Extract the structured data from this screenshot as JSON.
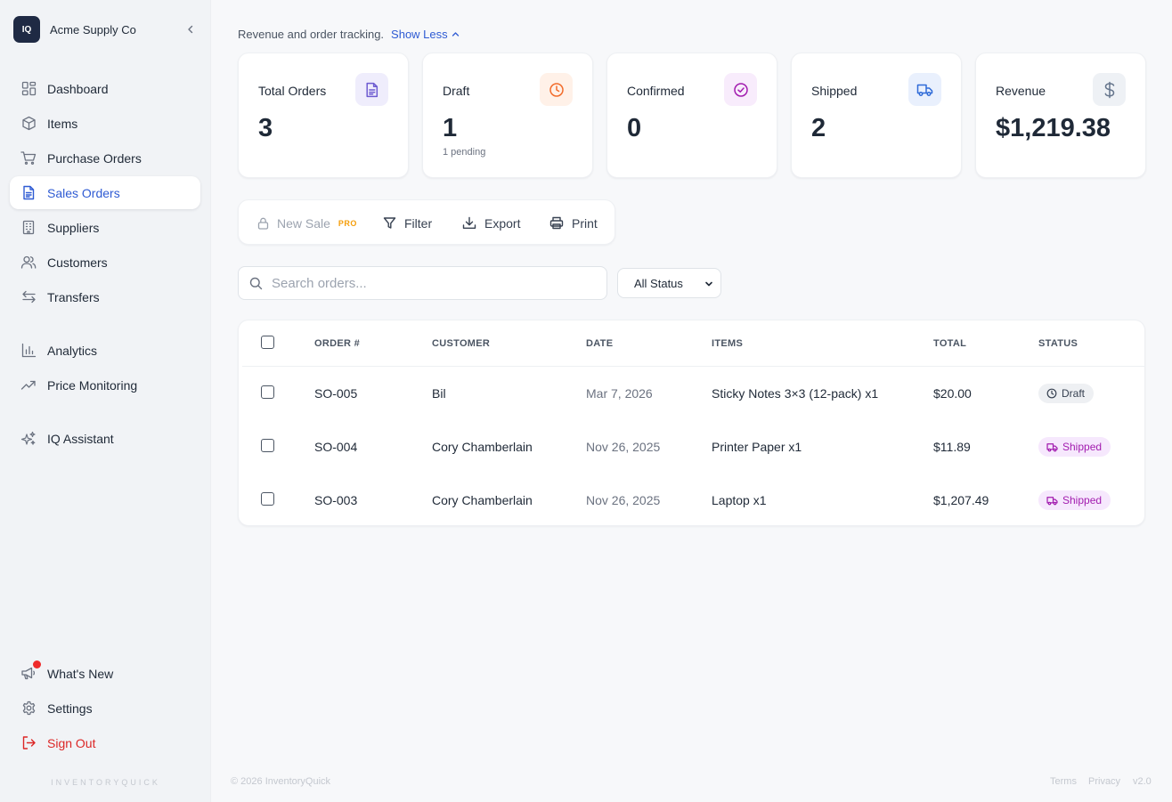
{
  "brand": {
    "logo_text": "IQ",
    "name": "Acme Supply Co"
  },
  "nav": {
    "dashboard": "Dashboard",
    "items": "Items",
    "purchase_orders": "Purchase Orders",
    "sales_orders": "Sales Orders",
    "suppliers": "Suppliers",
    "customers": "Customers",
    "transfers": "Transfers",
    "analytics": "Analytics",
    "price_monitoring": "Price Monitoring",
    "iq_assistant": "IQ Assistant",
    "whats_new": "What's New",
    "settings": "Settings",
    "sign_out": "Sign Out",
    "active": "sales_orders"
  },
  "sidebar_footer": "INVENTORYQUICK",
  "header": {
    "tagline": "Revenue and order tracking.",
    "toggle_label": "Show Less"
  },
  "stats": [
    {
      "label": "Total Orders",
      "value": "3",
      "icon": "document-icon",
      "color": "#6d5bd0",
      "bg": "#efedfc"
    },
    {
      "label": "Draft",
      "value": "1",
      "sub": "1 pending",
      "icon": "clock-icon",
      "color": "#f26b2a",
      "bg": "#fff1e8"
    },
    {
      "label": "Confirmed",
      "value": "0",
      "icon": "check-circle-icon",
      "color": "#a21caf",
      "bg": "#f8ecfc"
    },
    {
      "label": "Shipped",
      "value": "2",
      "icon": "truck-icon",
      "color": "#2f6bd8",
      "bg": "#e9f0fd"
    },
    {
      "label": "Revenue",
      "value": "$1,219.38",
      "icon": "dollar-icon",
      "color": "#64748b",
      "bg": "#eef1f5"
    }
  ],
  "toolbar": {
    "new_sale": "New Sale",
    "pro_badge": "PRO",
    "filter": "Filter",
    "export": "Export",
    "print": "Print"
  },
  "search": {
    "placeholder": "Search orders...",
    "value": ""
  },
  "status_filter": {
    "selected": "All Status"
  },
  "table": {
    "columns": [
      "ORDER #",
      "CUSTOMER",
      "DATE",
      "ITEMS",
      "TOTAL",
      "STATUS"
    ],
    "rows": [
      {
        "order": "SO-005",
        "customer": "Bil",
        "date": "Mar 7, 2026",
        "items": "Sticky Notes 3×3 (12-pack) x1",
        "total": "$20.00",
        "status": "Draft"
      },
      {
        "order": "SO-004",
        "customer": "Cory Chamberlain",
        "date": "Nov 26, 2025",
        "items": "Printer Paper x1",
        "total": "$11.89",
        "status": "Shipped"
      },
      {
        "order": "SO-003",
        "customer": "Cory Chamberlain",
        "date": "Nov 26, 2025",
        "items": "Laptop x1",
        "total": "$1,207.49",
        "status": "Shipped"
      }
    ]
  },
  "footer": {
    "copyright": "© 2026 InventoryQuick",
    "terms": "Terms",
    "privacy": "Privacy",
    "version": "v2.0"
  }
}
